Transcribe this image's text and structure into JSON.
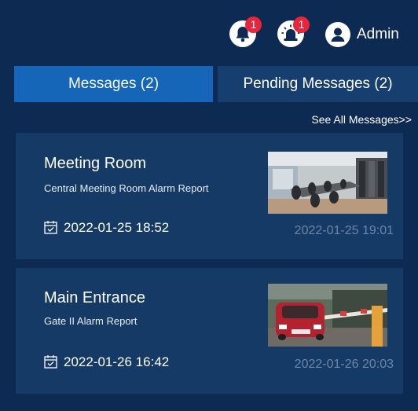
{
  "header": {
    "notifications": {
      "icon": "bell-icon",
      "count": "1"
    },
    "alarms": {
      "icon": "siren-icon",
      "count": "1"
    },
    "user": {
      "icon": "user-icon",
      "name": "Admin"
    }
  },
  "tabs": [
    {
      "label": "Messages (2)",
      "active": true
    },
    {
      "label": "Pending Messages (2)",
      "active": false
    }
  ],
  "see_all_label": "See All Messages>>",
  "messages": [
    {
      "title": "Meeting Room",
      "subtitle": "Central Meeting Room Alarm Report",
      "time": "2022-01-25 18:52",
      "time_secondary": "2022-01-25 19:01",
      "thumbnail": "meeting-room-snapshot"
    },
    {
      "title": "Main Entrance",
      "subtitle": "Gate II Alarm Report",
      "time": "2022-01-26 16:42",
      "time_secondary": "2022-01-26 20:03",
      "thumbnail": "gate-snapshot"
    }
  ],
  "colors": {
    "background": "#0d2a52",
    "active_tab": "#1565b8",
    "inactive_tab": "#163e6e",
    "card": "#153a66",
    "badge": "#e8263b",
    "muted_text": "#6d86a8"
  }
}
